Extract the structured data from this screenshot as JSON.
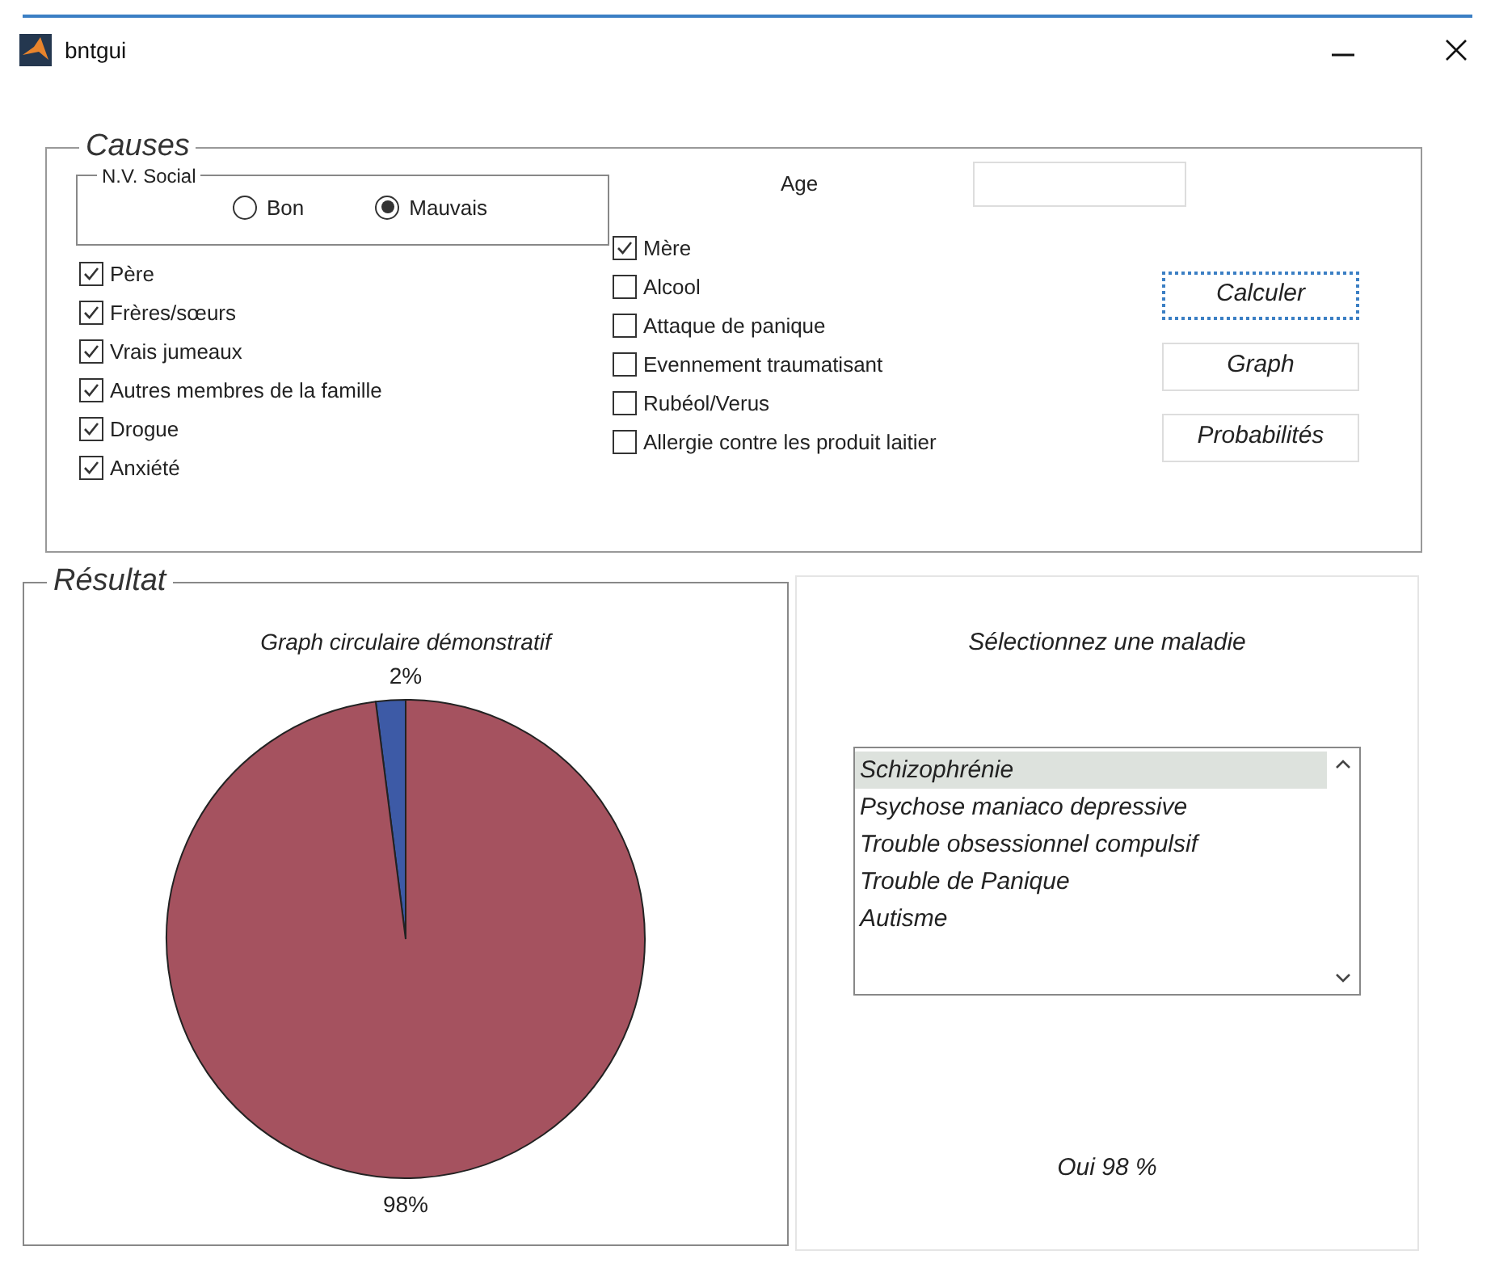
{
  "window": {
    "title": "bntgui"
  },
  "causes": {
    "title": "Causes",
    "social": {
      "title": "N.V. Social",
      "options": [
        {
          "label": "Bon",
          "selected": false
        },
        {
          "label": "Mauvais",
          "selected": true
        }
      ]
    },
    "age": {
      "label": "Age"
    },
    "left_checks": [
      {
        "label": "Père",
        "checked": true
      },
      {
        "label": "Frères/sœurs",
        "checked": true
      },
      {
        "label": "Vrais jumeaux",
        "checked": true
      },
      {
        "label": "Autres membres de la famille",
        "checked": true
      },
      {
        "label": "Drogue",
        "checked": true
      },
      {
        "label": "Anxiété",
        "checked": true
      }
    ],
    "right_checks": [
      {
        "label": "Mère",
        "checked": true
      },
      {
        "label": "Alcool",
        "checked": false
      },
      {
        "label": "Attaque de panique",
        "checked": false
      },
      {
        "label": "Evennement traumatisant",
        "checked": false
      },
      {
        "label": "Rubéol/Verus",
        "checked": false
      },
      {
        "label": "Allergie contre les produit laitier",
        "checked": false
      }
    ],
    "buttons": [
      {
        "label": "Calculer",
        "focused": true
      },
      {
        "label": "Graph",
        "focused": false
      },
      {
        "label": "Probabilités",
        "focused": false
      }
    ]
  },
  "result": {
    "title": "Résultat",
    "chart_data": {
      "type": "pie",
      "title": "Graph circulaire démonstratif",
      "values": [
        2,
        98
      ],
      "value_labels": [
        "2%",
        "98%"
      ],
      "colors": [
        "#3d5aa6",
        "#a5525f"
      ]
    }
  },
  "disease_panel": {
    "prompt": "Sélectionnez une maladie",
    "items": [
      {
        "label": "Schizophrénie",
        "selected": true
      },
      {
        "label": "Psychose maniaco depressive",
        "selected": false
      },
      {
        "label": "Trouble obsessionnel compulsif",
        "selected": false
      },
      {
        "label": "Trouble de Panique",
        "selected": false
      },
      {
        "label": "Autisme",
        "selected": false
      }
    ],
    "result": "Oui 98 %"
  }
}
